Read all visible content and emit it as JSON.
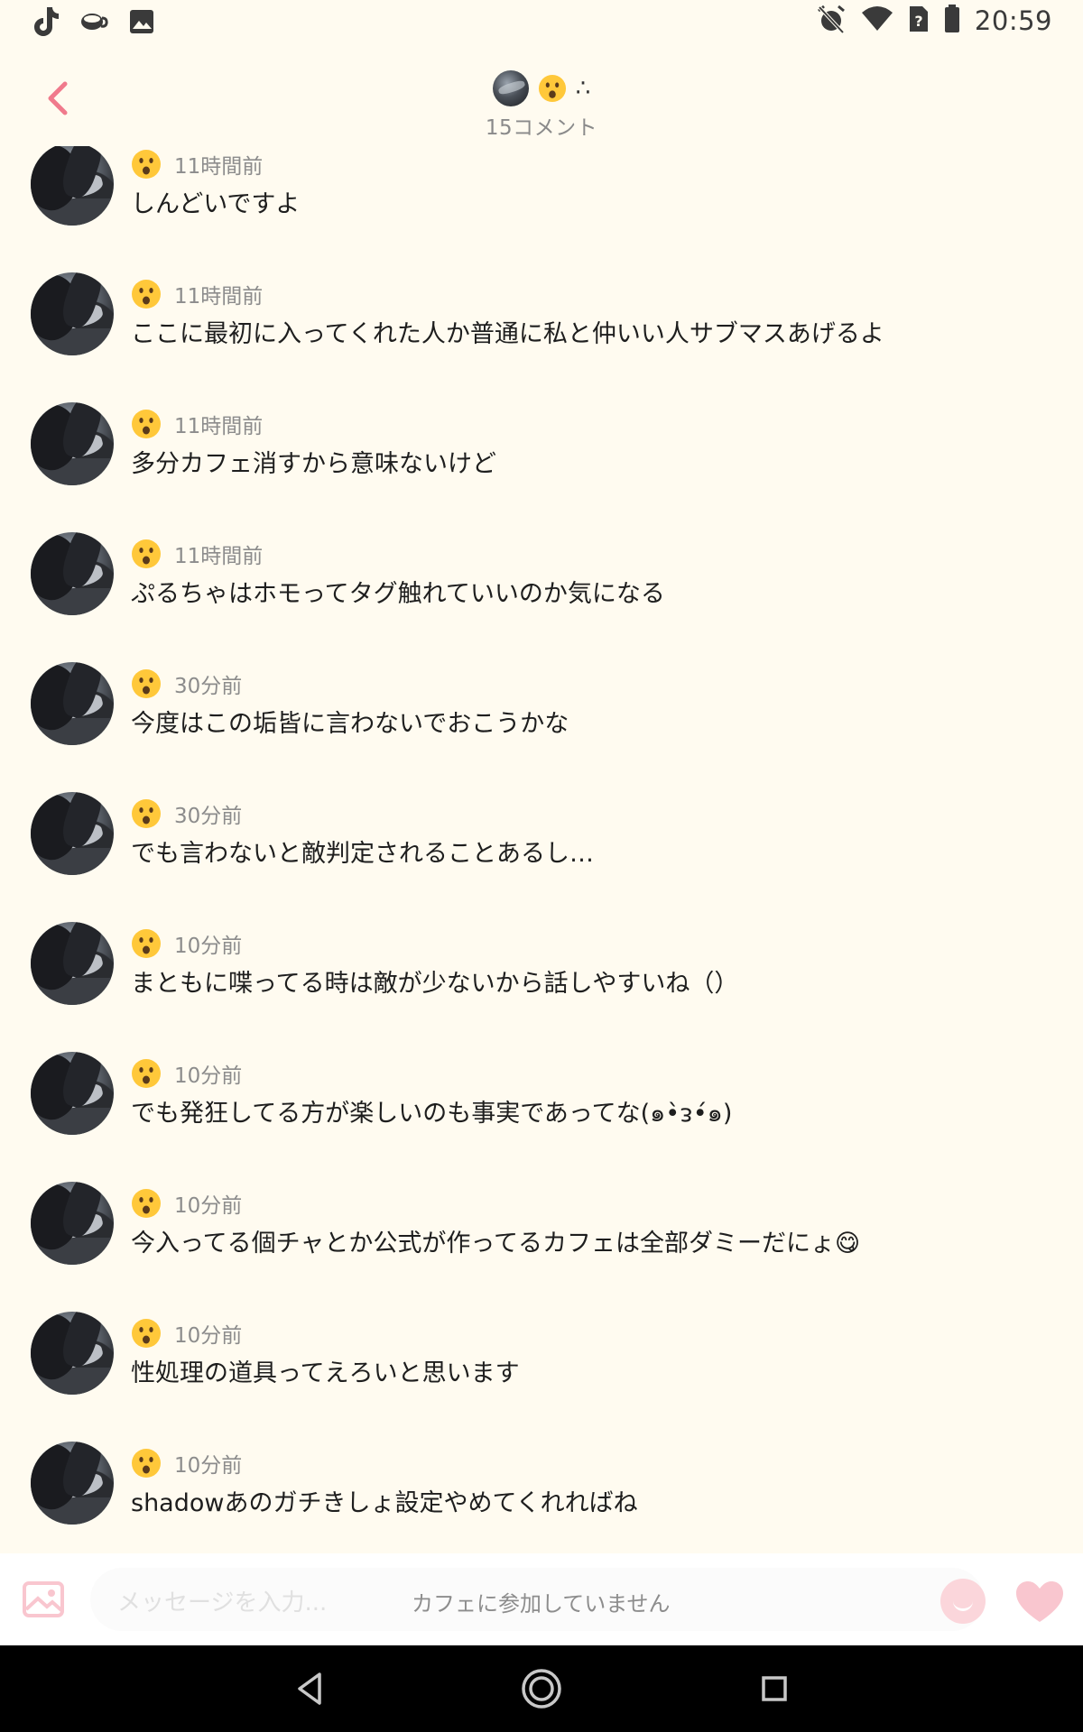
{
  "status_bar": {
    "time": "20:59",
    "left_icons": [
      "tiktok-icon",
      "cafe-icon",
      "gallery-icon"
    ],
    "right_icons": [
      "alarm-off-icon",
      "wifi-icon",
      "no-sim-icon",
      "battery-icon"
    ]
  },
  "header": {
    "title_dots": "∴",
    "comment_count": "15コメント"
  },
  "comments": [
    {
      "time": "11時間前",
      "text": "しんどいですよ"
    },
    {
      "time": "11時間前",
      "text": "ここに最初に入ってくれた人か普通に私と仲いい人サブマスあげるよ"
    },
    {
      "time": "11時間前",
      "text": "多分カフェ消すから意味ないけど"
    },
    {
      "time": "11時間前",
      "text": "ぷるちゃはホモってタグ触れていいのか気になる"
    },
    {
      "time": "30分前",
      "text": "今度はこの垢皆に言わないでおこうかな"
    },
    {
      "time": "30分前",
      "text": "でも言わないと敵判定されることあるし…"
    },
    {
      "time": "10分前",
      "text": "まともに喋ってる時は敵が少ないから話しやすいね（）"
    },
    {
      "time": "10分前",
      "text": "でも発狂してる方が楽しいのも事実であってな(๑•̀ᴈ•́๑)"
    },
    {
      "time": "10分前",
      "text": "今入ってる個チャとか公式が作ってるカフェは全部ダミーだにょ😋"
    },
    {
      "time": "10分前",
      "text": "性処理の道具ってえろいと思います"
    },
    {
      "time": "10分前",
      "text": "shadowあのガチきしょ設定やめてくれればね"
    }
  ],
  "input_bar": {
    "placeholder": "メッセージを入力...",
    "status": "カフェに参加していません"
  },
  "colors": {
    "background": "#fffbf0",
    "accent": "#f07a8c",
    "muted_text": "#8c8c8c"
  }
}
